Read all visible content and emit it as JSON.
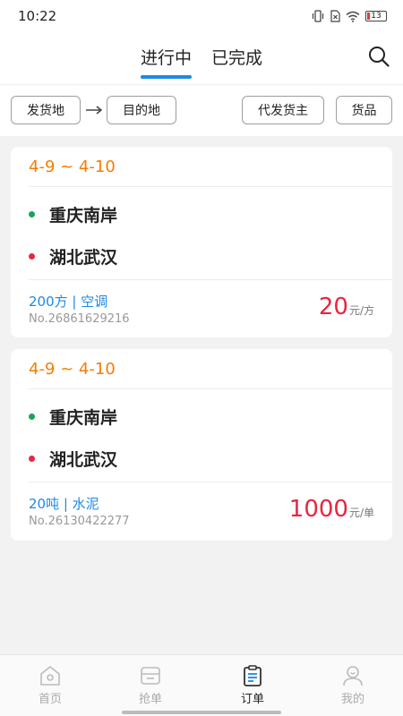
{
  "status_bar": {
    "time": "10:22",
    "battery": "13"
  },
  "header": {
    "tabs": [
      {
        "label": "进行中",
        "active": true
      },
      {
        "label": "已完成",
        "active": false
      }
    ]
  },
  "filters": {
    "origin": "发货地",
    "destination": "目的地",
    "shipper": "代发货主",
    "goods": "货品"
  },
  "orders": [
    {
      "date_range": "4-9 ~ 4-10",
      "from": "重庆南岸",
      "to": "湖北武汉",
      "cargo": "200方 | 空调",
      "order_no": "No.26861629216",
      "price": "20",
      "unit": "元/方"
    },
    {
      "date_range": "4-9 ~ 4-10",
      "from": "重庆南岸",
      "to": "湖北武汉",
      "cargo": "20吨 | 水泥",
      "order_no": "No.26130422277",
      "price": "1000",
      "unit": "元/单"
    }
  ],
  "colors": {
    "accent": "#1e88e5",
    "date": "#f57c00",
    "price": "#e8263d",
    "from_dot": "#1aa35a",
    "to_dot": "#e8263d"
  },
  "bottom_nav": [
    {
      "label": "首页",
      "icon": "home-icon",
      "active": false
    },
    {
      "label": "抢单",
      "icon": "grab-order-icon",
      "active": false
    },
    {
      "label": "订单",
      "icon": "order-clipboard-icon",
      "active": true
    },
    {
      "label": "我的",
      "icon": "profile-icon",
      "active": false
    }
  ]
}
